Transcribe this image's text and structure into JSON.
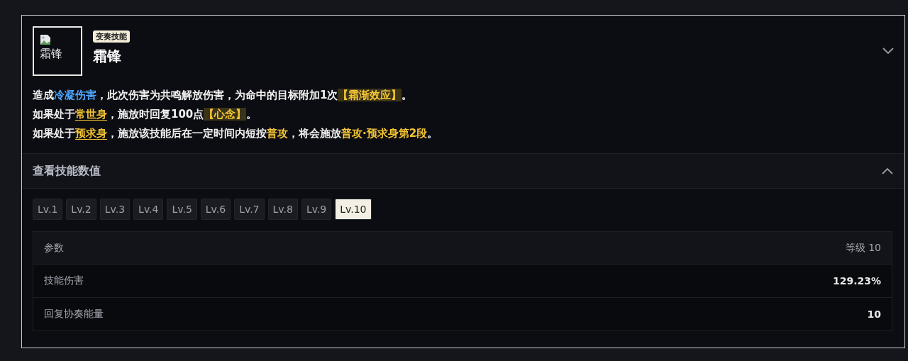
{
  "skill": {
    "icon_alt": "霜锋",
    "tag": "变奏技能",
    "name": "霜锋",
    "expanded": true,
    "description": [
      [
        {
          "kind": "plain",
          "text": "造成"
        },
        {
          "kind": "element",
          "text": "冷凝伤害"
        },
        {
          "kind": "plain",
          "text": "，此次伤害为共鸣解放伤害，为命中的目标附加1次"
        },
        {
          "kind": "effect",
          "text": "【霜渐效应】"
        },
        {
          "kind": "plain",
          "text": "。"
        }
      ],
      [
        {
          "kind": "plain",
          "text": "如果处于"
        },
        {
          "kind": "term",
          "text": "常世身"
        },
        {
          "kind": "plain",
          "text": "，施放时回复100点"
        },
        {
          "kind": "effect",
          "text": "【心念】"
        },
        {
          "kind": "plain",
          "text": "。"
        }
      ],
      [
        {
          "kind": "plain",
          "text": "如果处于"
        },
        {
          "kind": "term",
          "text": "预求身"
        },
        {
          "kind": "plain",
          "text": "，施放该技能后在一定时间内短按"
        },
        {
          "kind": "keyword",
          "text": "普攻"
        },
        {
          "kind": "plain",
          "text": "，将会施放"
        },
        {
          "kind": "keyword",
          "text": "普攻·预求身第2段"
        },
        {
          "kind": "plain",
          "text": "。"
        }
      ]
    ]
  },
  "values_section": {
    "title": "查看技能数值",
    "expanded": true,
    "levels": [
      {
        "label": "Lv.1",
        "selected": false
      },
      {
        "label": "Lv.2",
        "selected": false
      },
      {
        "label": "Lv.3",
        "selected": false
      },
      {
        "label": "Lv.4",
        "selected": false
      },
      {
        "label": "Lv.5",
        "selected": false
      },
      {
        "label": "Lv.6",
        "selected": false
      },
      {
        "label": "Lv.7",
        "selected": false
      },
      {
        "label": "Lv.8",
        "selected": false
      },
      {
        "label": "Lv.9",
        "selected": false
      },
      {
        "label": "Lv.10",
        "selected": true
      }
    ],
    "table": {
      "columns": [
        "参数",
        "等级 10"
      ],
      "rows": [
        {
          "name": "技能伤害",
          "value": "129.23%"
        },
        {
          "name": "回复协奏能量",
          "value": "10"
        }
      ]
    }
  }
}
